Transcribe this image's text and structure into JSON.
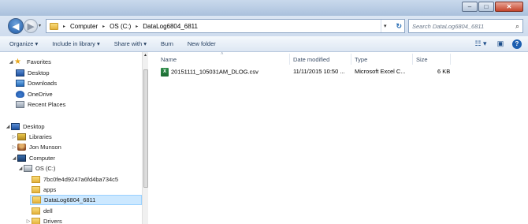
{
  "window": {
    "minimize_icon": "minimize-icon",
    "maximize_icon": "maximize-icon",
    "close_icon": "close-icon",
    "minimize_glyph": "–",
    "maximize_glyph": "□",
    "close_glyph": "✕"
  },
  "navigation": {
    "back_glyph": "◀",
    "forward_glyph": "▶",
    "recent_glyph": "▾"
  },
  "address": {
    "breadcrumbs": [
      "Computer",
      "OS (C:)",
      "DataLog6804_6811"
    ],
    "separator": "▸",
    "dropdown_glyph": "▾",
    "refresh_glyph": "↻"
  },
  "search": {
    "placeholder": "Search DataLog6804_6811",
    "icon_glyph": "⌕"
  },
  "toolbar": {
    "organize": "Organize ▾",
    "include_in_library": "Include in library ▾",
    "share_with": "Share with ▾",
    "burn": "Burn",
    "new_folder": "New folder",
    "views_glyph": "☷ ▾",
    "preview_glyph": "▣",
    "help_glyph": "?"
  },
  "sidebar": {
    "items": [
      {
        "label": "Favorites",
        "tri": "◢",
        "icon": "star-icon"
      },
      {
        "label": "Desktop",
        "tri": "",
        "icon": "desktop-icon"
      },
      {
        "label": "Downloads",
        "tri": "",
        "icon": "downloads-icon"
      },
      {
        "label": "OneDrive",
        "tri": "",
        "icon": "onedrive-icon"
      },
      {
        "label": "Recent Places",
        "tri": "",
        "icon": "recent-places-icon"
      },
      {
        "label": "Desktop",
        "tri": "◢",
        "icon": "desktop-icon"
      },
      {
        "label": "Libraries",
        "tri": "▷",
        "icon": "libraries-icon"
      },
      {
        "label": "Jon Munson",
        "tri": "▷",
        "icon": "user-folder-icon"
      },
      {
        "label": "Computer",
        "tri": "◢",
        "icon": "computer-icon"
      },
      {
        "label": "OS (C:)",
        "tri": "◢",
        "icon": "drive-icon"
      },
      {
        "label": "7bc0fe4d9247a6fd4ba734c5",
        "tri": "",
        "icon": "folder-icon"
      },
      {
        "label": "apps",
        "tri": "",
        "icon": "folder-icon"
      },
      {
        "label": "DataLog6804_6811",
        "tri": "",
        "icon": "folder-icon"
      },
      {
        "label": "dell",
        "tri": "",
        "icon": "folder-icon"
      },
      {
        "label": "Drivers",
        "tri": "▷",
        "icon": "folder-icon"
      }
    ]
  },
  "table": {
    "columns": [
      "Name",
      "Date modified",
      "Type",
      "Size"
    ],
    "sort_glyph": "˄",
    "rows": [
      {
        "name": "20151111_105031AM_DLOG.csv",
        "date_modified": "11/11/2015 10:50 ...",
        "type": "Microsoft Excel C...",
        "size": "6 KB",
        "icon": "excel-csv-icon",
        "icon_glyph": "X"
      }
    ]
  }
}
